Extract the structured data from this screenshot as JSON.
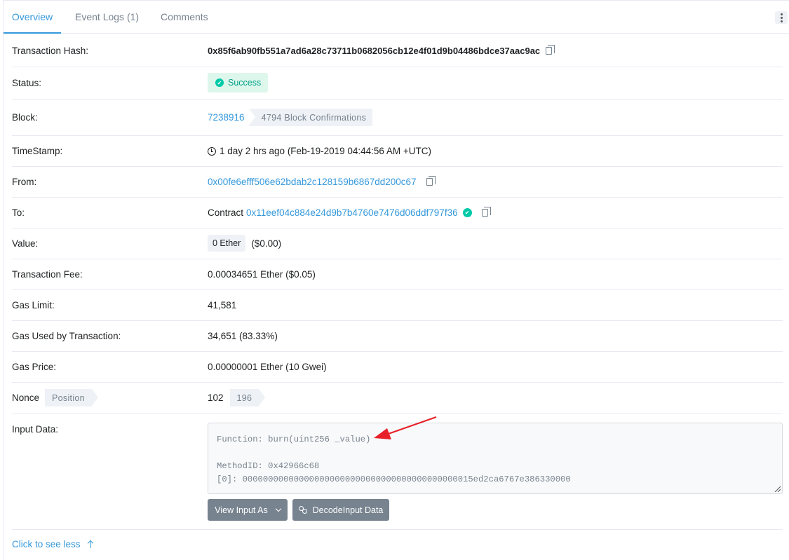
{
  "tabs": [
    {
      "label": "Overview"
    },
    {
      "label": "Event Logs (1)"
    },
    {
      "label": "Comments"
    }
  ],
  "rows": {
    "tx_hash": {
      "label": "Transaction Hash:",
      "value": "0x85f6ab90fb551a7ad6a28c73711b0682056cb12e4f01d9b04486bdce37aac9ac"
    },
    "status": {
      "label": "Status:",
      "value": "Success"
    },
    "block": {
      "label": "Block:",
      "value": "7238916",
      "confirmations": "4794 Block Confirmations"
    },
    "timestamp": {
      "label": "TimeStamp:",
      "value": "1 day 2 hrs ago (Feb-19-2019 04:44:56 AM +UTC)"
    },
    "from": {
      "label": "From:",
      "value": "0x00fe6efff506e62bdab2c128159b6867dd200c67"
    },
    "to": {
      "label": "To:",
      "prefix": "Contract",
      "value": "0x11eef04c884e24d9b7b4760e7476d06ddf797f36"
    },
    "value": {
      "label": "Value:",
      "ether": "0 Ether",
      "usd": "($0.00)"
    },
    "fee": {
      "label": "Transaction Fee:",
      "value": "0.00034651 Ether ($0.05)"
    },
    "gas_limit": {
      "label": "Gas Limit:",
      "value": "41,581"
    },
    "gas_used": {
      "label": "Gas Used by Transaction:",
      "value": "34,651 (83.33%)"
    },
    "gas_price": {
      "label": "Gas Price:",
      "value": "0.00000001 Ether (10 Gwei)"
    },
    "nonce": {
      "label": "Nonce",
      "position_tag": "Position",
      "value": "102",
      "position": "196"
    },
    "input": {
      "label": "Input Data:",
      "function_line": "Function: burn(uint256 _value)",
      "method_line": "MethodID: 0x42966c68",
      "param_line": "[0]:  000000000000000000000000000000000000000000015ed2ca6767e386330000"
    }
  },
  "buttons": {
    "view_input": "View Input As",
    "decode": "DecodeInput Data"
  },
  "see_less": "Click to see less",
  "colors": {
    "link": "#3498db",
    "success_bg": "#def7ec",
    "success_text": "#00a186",
    "button": "#77838f",
    "annotation_arrow": "#e8202a"
  }
}
